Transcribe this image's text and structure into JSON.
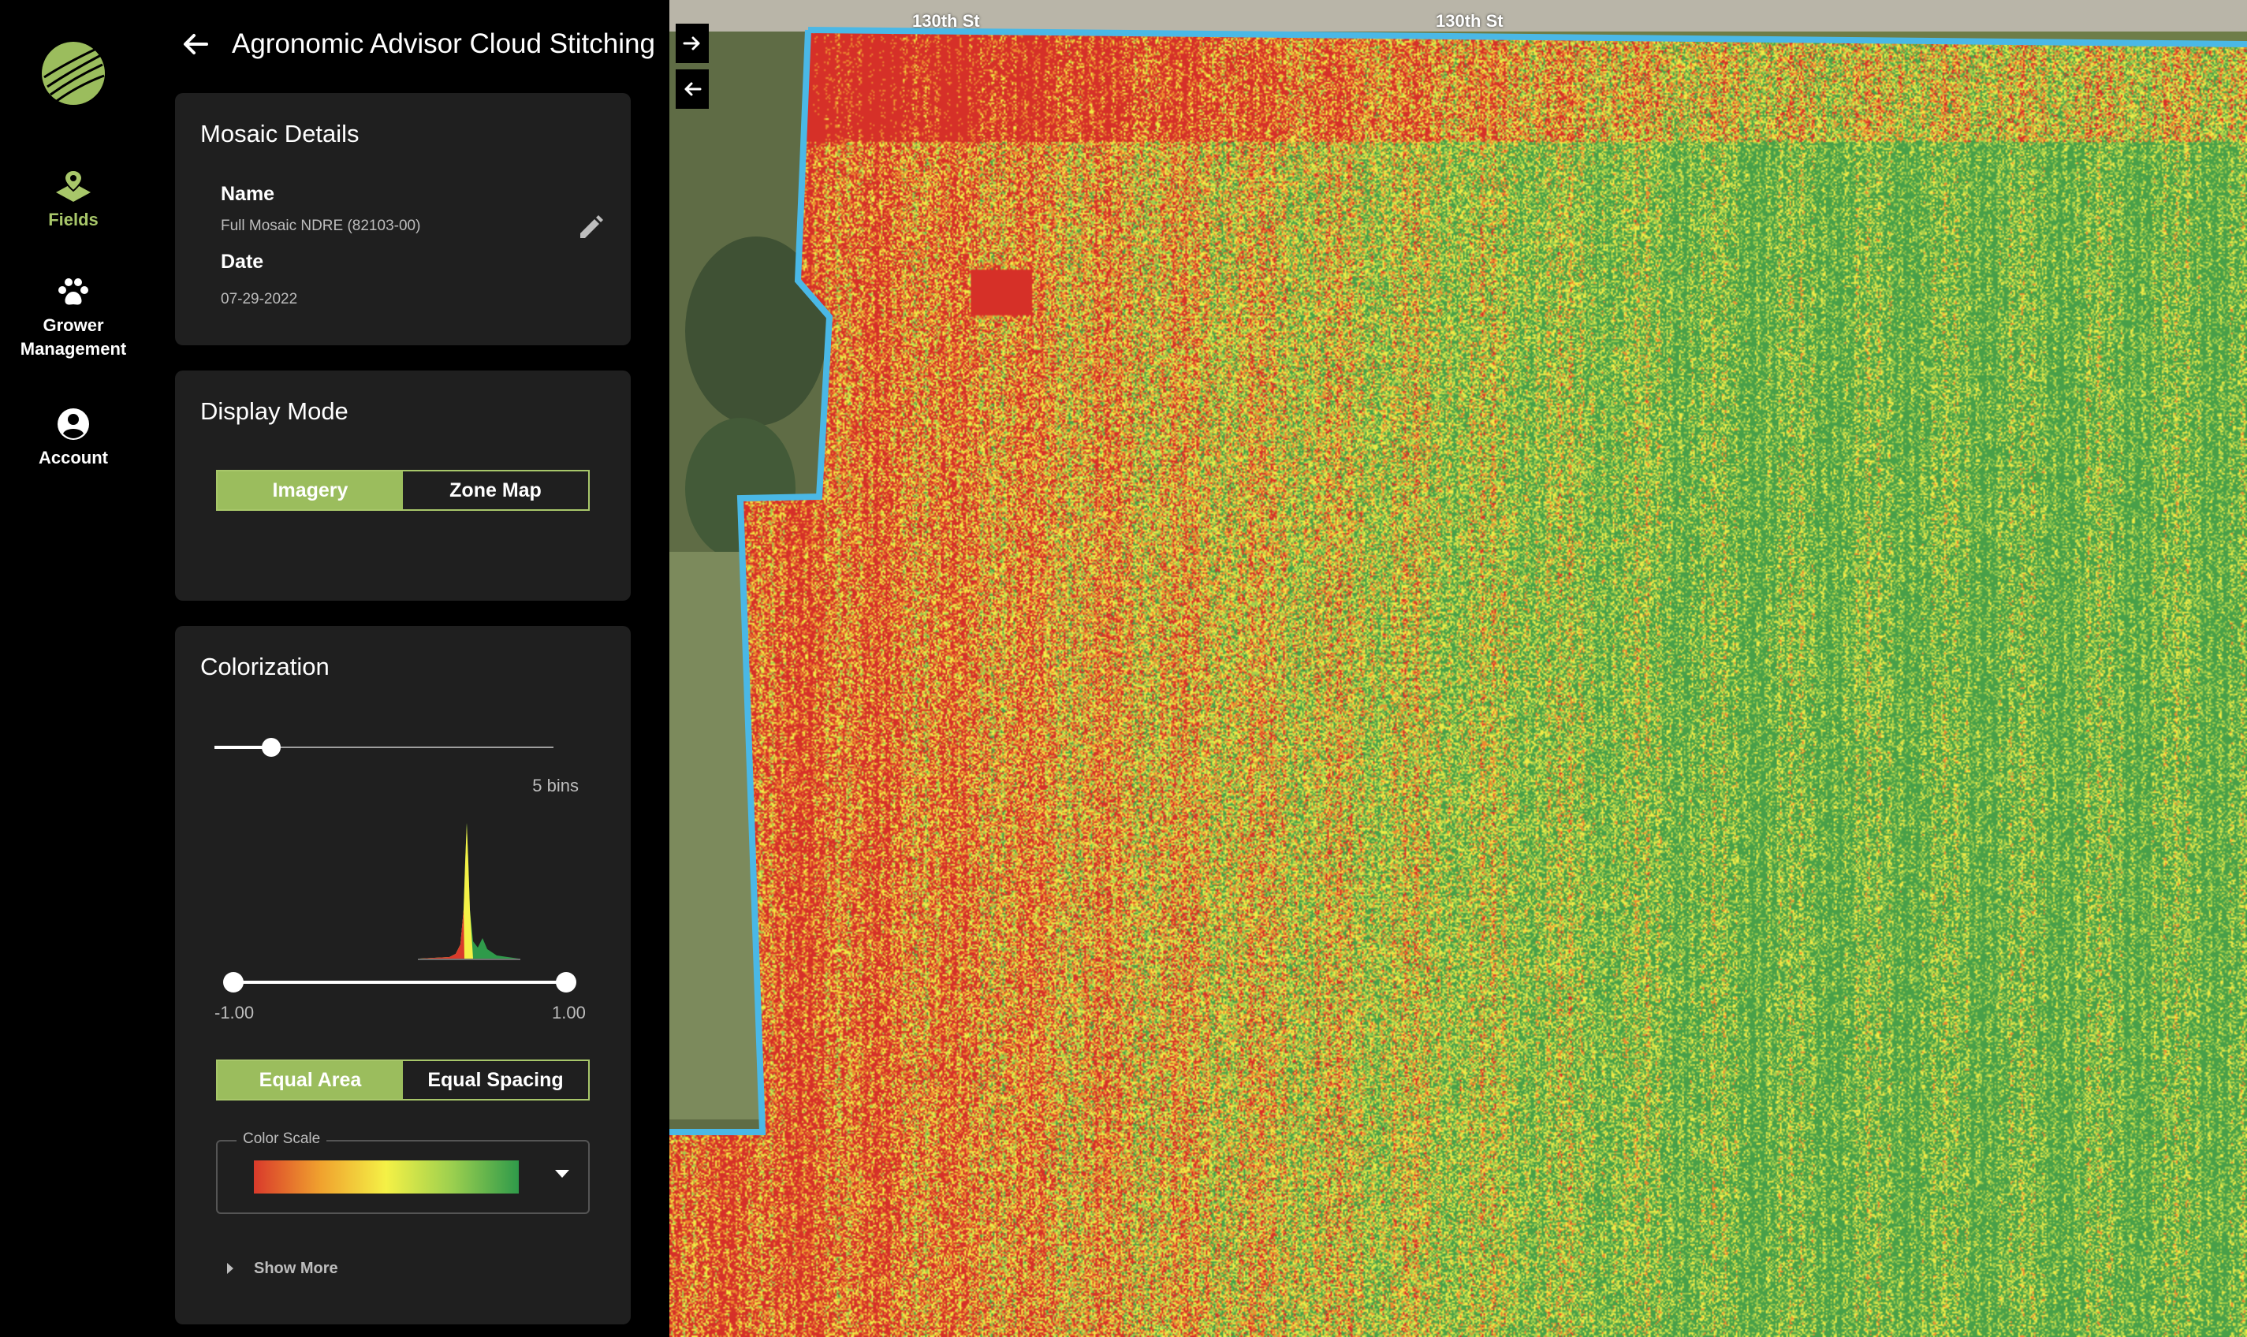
{
  "nav": {
    "items": [
      {
        "label": "Fields",
        "icon": "fields-pin-icon",
        "active": true
      },
      {
        "label": "Grower\nManagement",
        "icon": "paw-icon",
        "active": false
      },
      {
        "label": "Account",
        "icon": "account-circle-icon",
        "active": false
      }
    ],
    "logo": "agronomic-leaf-logo",
    "accent_color": "#a8c76a"
  },
  "header": {
    "title": "Agronomic Advisor Cloud Stitching",
    "back_icon": "arrow-left-icon"
  },
  "mosaic_details": {
    "title": "Mosaic Details",
    "name_label": "Name",
    "name_value": "Full Mosaic NDRE (82103-00)",
    "date_label": "Date",
    "date_value": "07-29-2022",
    "edit_icon": "pencil-icon"
  },
  "display_mode": {
    "title": "Display Mode",
    "options": [
      "Imagery",
      "Zone Map"
    ],
    "selected": "Imagery"
  },
  "colorization": {
    "title": "Colorization",
    "bins": {
      "value": 5,
      "min": 2,
      "max": 20,
      "label": "5 bins"
    },
    "range": {
      "min": -1.0,
      "max": 1.0,
      "min_label": "-1.00",
      "max_label": "1.00"
    },
    "spacing_options": [
      "Equal Area",
      "Equal Spacing"
    ],
    "spacing_selected": "Equal Area",
    "color_scale_label": "Color Scale",
    "color_scale_colors": [
      "#d93a2b",
      "#f0a12e",
      "#f4f146",
      "#9bcf4f",
      "#2f9a4a"
    ],
    "show_more_label": "Show More"
  },
  "map": {
    "streets": [
      "130th St",
      "130th St"
    ],
    "boundary_color": "#4ab8e6",
    "expand_icon": "arrow-right-icon",
    "collapse_icon": "arrow-left-icon"
  }
}
